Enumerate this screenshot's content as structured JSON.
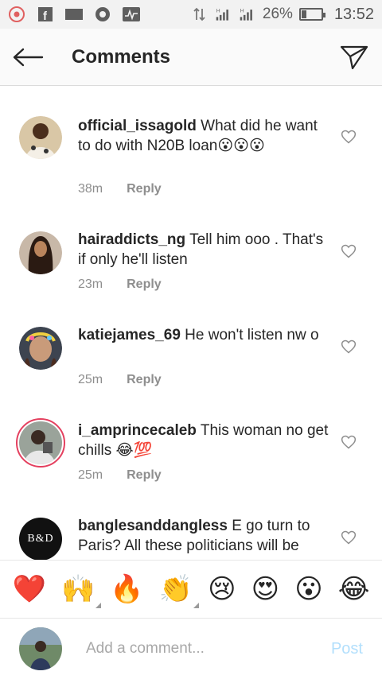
{
  "status_bar": {
    "battery": "26%",
    "battery_level": 0.26,
    "time": "13:52",
    "network_label": "1l"
  },
  "header": {
    "title": "Comments"
  },
  "comments": [
    {
      "username": "official_issagold",
      "text": "What did he want to do with N20B loan😮😮😮",
      "time": "38m",
      "reply": "Reply"
    },
    {
      "username": "hairaddicts_ng",
      "text": "Tell him ooo . That's if only he'll listen",
      "time": "23m",
      "reply": "Reply"
    },
    {
      "username": "katiejames_69",
      "text": "He won't listen nw o",
      "time": "25m",
      "reply": "Reply"
    },
    {
      "username": "i_amprincecaleb",
      "text": "This woman no get chills 😂💯",
      "time": "25m",
      "reply": "Reply"
    },
    {
      "username": "banglesanddangless",
      "text": "E go turn to Paris? All these politicians will be",
      "time": "",
      "reply": "",
      "avatar_text": "B&D"
    }
  ],
  "emojis": [
    {
      "glyph": "❤️",
      "name": "red-heart"
    },
    {
      "glyph": "🙌",
      "name": "raising-hands"
    },
    {
      "glyph": "🔥",
      "name": "fire"
    },
    {
      "glyph": "👏",
      "name": "clapping-hands"
    },
    {
      "glyph": "😢",
      "name": "crying-face"
    },
    {
      "glyph": "😍",
      "name": "heart-eyes"
    },
    {
      "glyph": "😮",
      "name": "surprised-face"
    },
    {
      "glyph": "😂",
      "name": "tears-of-joy"
    }
  ],
  "composer": {
    "placeholder": "Add a comment...",
    "post_label": "Post"
  },
  "colors": {
    "post_disabled": "#b2dffc",
    "meta_gray": "#8e8e8e",
    "story_ring": "#e4405f"
  }
}
